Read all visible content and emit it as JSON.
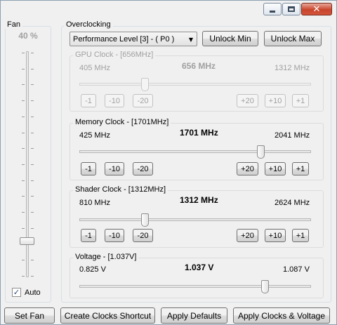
{
  "caption": {
    "minimize_icon": "minimize-icon",
    "maximize_icon": "maximize-icon",
    "close_glyph": "✕"
  },
  "fan": {
    "title": "Fan",
    "percent_label": "40 %",
    "percent_value": 40,
    "auto_label": "Auto",
    "auto_checked": true,
    "check_glyph": "✓"
  },
  "overclocking": {
    "title": "Overclocking",
    "performance_level": "Performance Level [3] - ( P0 )",
    "dropdown_arrow": "▼",
    "unlock_min_label": "Unlock Min",
    "unlock_max_label": "Unlock Max"
  },
  "gpu_clock": {
    "title": "GPU Clock - [656MHz]",
    "min": "405 MHz",
    "current": "656 MHz",
    "max": "1312 MHz",
    "enabled": false,
    "steps_minus": [
      "-1",
      "-10",
      "-20"
    ],
    "steps_plus": [
      "+20",
      "+10",
      "+1"
    ]
  },
  "memory_clock": {
    "title": "Memory Clock - [1701MHz]",
    "min": "425 MHz",
    "current": "1701 MHz",
    "max": "2041 MHz",
    "enabled": true,
    "steps_minus": [
      "-1",
      "-10",
      "-20"
    ],
    "steps_plus": [
      "+20",
      "+10",
      "+1"
    ]
  },
  "shader_clock": {
    "title": "Shader Clock - [1312MHz]",
    "min": "810 MHz",
    "current": "1312 MHz",
    "max": "2624 MHz",
    "enabled": true,
    "steps_minus": [
      "-1",
      "-10",
      "-20"
    ],
    "steps_plus": [
      "+20",
      "+10",
      "+1"
    ]
  },
  "voltage": {
    "title": "Voltage - [1.037V]",
    "min": "0.825 V",
    "current": "1.037 V",
    "max": "1.087 V",
    "enabled": true
  },
  "footer": {
    "set_fan_label": "Set Fan",
    "create_shortcut_label": "Create Clocks Shortcut",
    "apply_defaults_label": "Apply Defaults",
    "apply_clocks_label": "Apply Clocks & Voltage"
  }
}
